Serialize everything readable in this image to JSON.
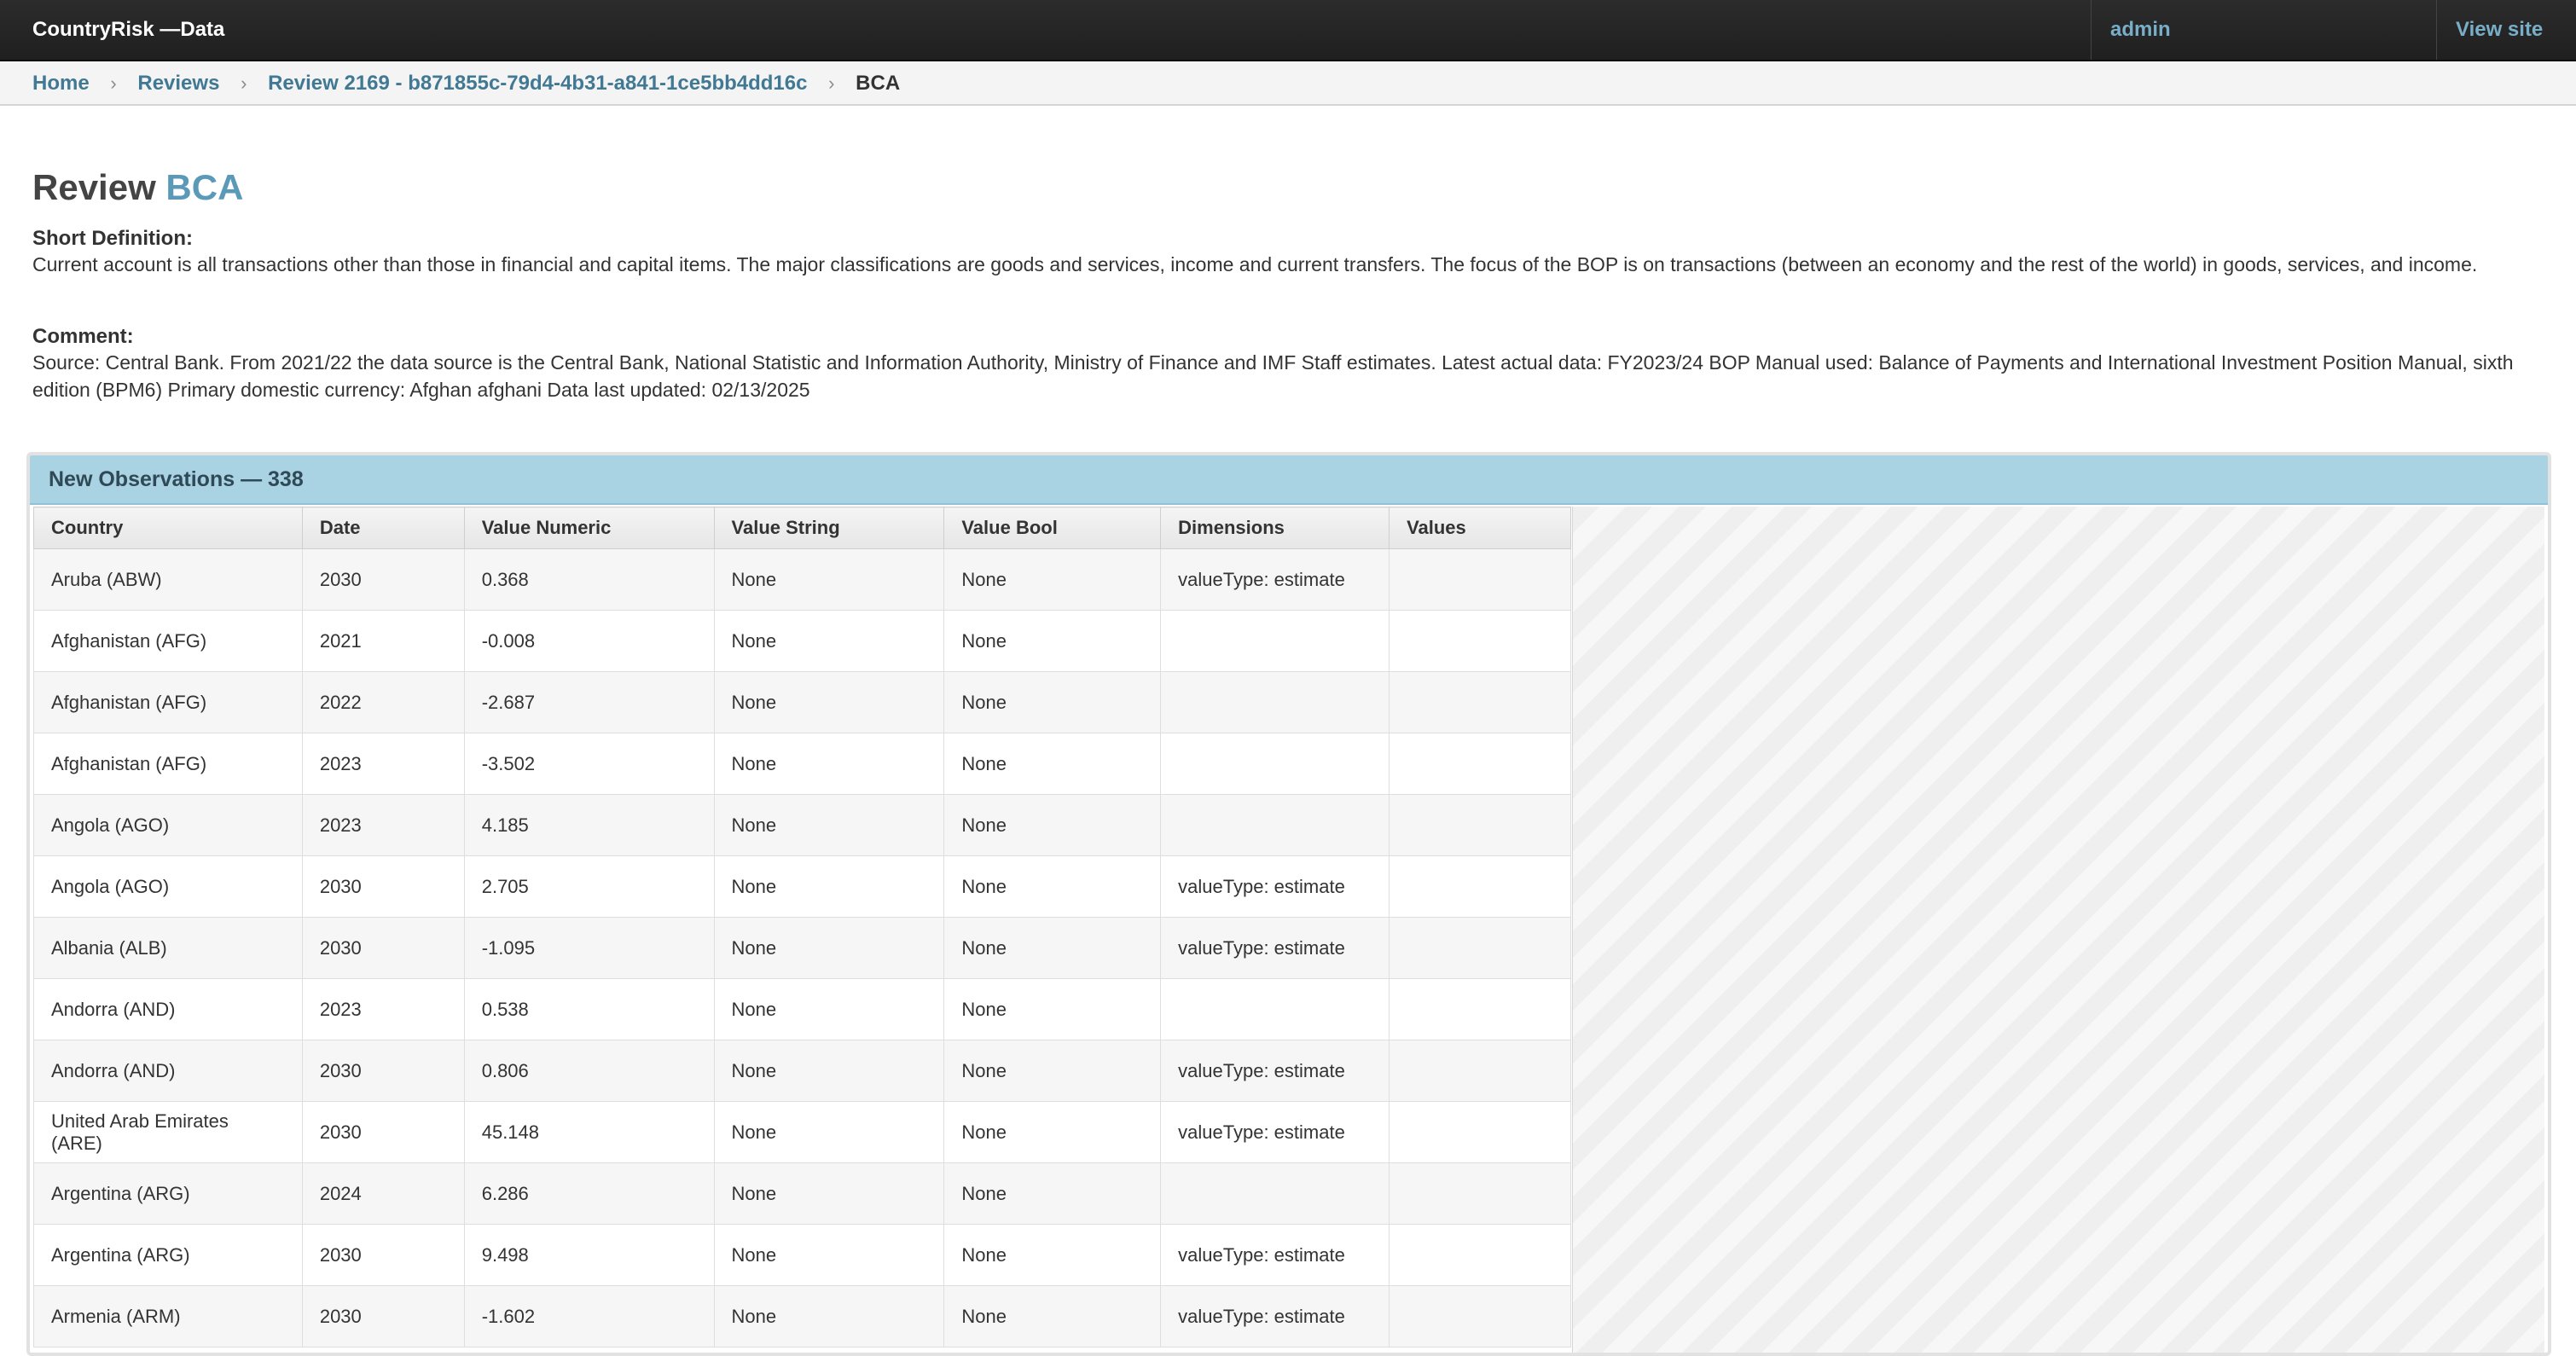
{
  "header": {
    "brand": "CountryRisk —Data",
    "user": "admin",
    "view_site": "View site"
  },
  "breadcrumbs": {
    "home": "Home",
    "reviews": "Reviews",
    "review": "Review 2169 - b871855c-79d4-4b31-a841-1ce5bb4dd16c",
    "current": "BCA",
    "separator": "›"
  },
  "page": {
    "title_prefix": "Review",
    "title_code": "BCA",
    "short_definition_label": "Short Definition:",
    "short_definition": "Current account is all transactions other than those in financial and capital items. The major classifications are goods and services, income and current transfers. The focus of the BOP is on transactions (between an economy and the rest of the world) in goods, services, and income.",
    "comment_label": "Comment:",
    "comment": "Source: Central Bank. From 2021/22 the data source is the Central Bank, National Statistic and Information Authority, Ministry of Finance and IMF Staff estimates. Latest actual data: FY2023/24 BOP Manual used: Balance of Payments and International Investment Position Manual, sixth edition (BPM6) Primary domestic currency: Afghan afghani Data last updated: 02/13/2025"
  },
  "observations": {
    "title": "New Observations — 338",
    "columns": [
      "Country",
      "Date",
      "Value Numeric",
      "Value String",
      "Value Bool",
      "Dimensions",
      "Values"
    ],
    "rows": [
      [
        "Aruba (ABW)",
        "2030",
        "0.368",
        "None",
        "None",
        "valueType: estimate",
        ""
      ],
      [
        "Afghanistan (AFG)",
        "2021",
        "-0.008",
        "None",
        "None",
        "",
        ""
      ],
      [
        "Afghanistan (AFG)",
        "2022",
        "-2.687",
        "None",
        "None",
        "",
        ""
      ],
      [
        "Afghanistan (AFG)",
        "2023",
        "-3.502",
        "None",
        "None",
        "",
        ""
      ],
      [
        "Angola (AGO)",
        "2023",
        "4.185",
        "None",
        "None",
        "",
        ""
      ],
      [
        "Angola (AGO)",
        "2030",
        "2.705",
        "None",
        "None",
        "valueType: estimate",
        ""
      ],
      [
        "Albania (ALB)",
        "2030",
        "-1.095",
        "None",
        "None",
        "valueType: estimate",
        ""
      ],
      [
        "Andorra (AND)",
        "2023",
        "0.538",
        "None",
        "None",
        "",
        ""
      ],
      [
        "Andorra (AND)",
        "2030",
        "0.806",
        "None",
        "None",
        "valueType: estimate",
        ""
      ],
      [
        "United Arab Emirates (ARE)",
        "2030",
        "45.148",
        "None",
        "None",
        "valueType: estimate",
        ""
      ],
      [
        "Argentina (ARG)",
        "2024",
        "6.286",
        "None",
        "None",
        "",
        ""
      ],
      [
        "Argentina (ARG)",
        "2030",
        "9.498",
        "None",
        "None",
        "valueType: estimate",
        ""
      ],
      [
        "Armenia (ARM)",
        "2030",
        "-1.602",
        "None",
        "None",
        "valueType: estimate",
        ""
      ]
    ]
  }
}
